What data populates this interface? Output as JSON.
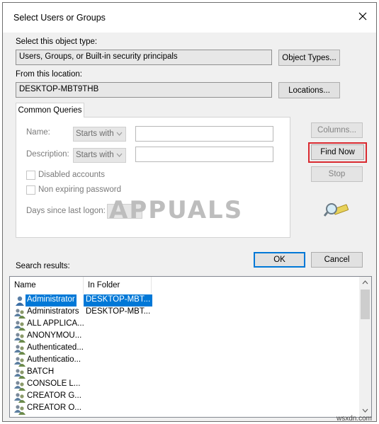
{
  "window": {
    "title": "Select Users or Groups"
  },
  "object_type": {
    "label": "Select this object type:",
    "value": "Users, Groups, or Built-in security principals",
    "button": "Object Types..."
  },
  "location": {
    "label": "From this location:",
    "value": "DESKTOP-MBT9THB",
    "button": "Locations..."
  },
  "queries": {
    "tab": "Common Queries",
    "name_label": "Name:",
    "name_mode": "Starts with",
    "description_label": "Description:",
    "description_mode": "Starts with",
    "disabled_accounts": "Disabled accounts",
    "non_expiring": "Non expiring password",
    "days_label": "Days since last logon:"
  },
  "buttons": {
    "columns": "Columns...",
    "find_now": "Find Now",
    "stop": "Stop",
    "ok": "OK",
    "cancel": "Cancel"
  },
  "watermark": "APPUALS",
  "results": {
    "label": "Search results:",
    "columns": [
      "Name",
      "In Folder"
    ],
    "rows": [
      {
        "name": "Administrator",
        "folder": "DESKTOP-MBT...",
        "icon": "user-icon"
      },
      {
        "name": "Administrators",
        "folder": "DESKTOP-MBT...",
        "icon": "group-icon"
      },
      {
        "name": "ALL APPLICA...",
        "folder": "",
        "icon": "group-icon"
      },
      {
        "name": "ANONYMOU...",
        "folder": "",
        "icon": "group-icon"
      },
      {
        "name": "Authenticated...",
        "folder": "",
        "icon": "group-icon"
      },
      {
        "name": "Authenticatio...",
        "folder": "",
        "icon": "group-icon"
      },
      {
        "name": "BATCH",
        "folder": "",
        "icon": "group-icon"
      },
      {
        "name": "CONSOLE L...",
        "folder": "",
        "icon": "group-icon"
      },
      {
        "name": "CREATOR G...",
        "folder": "",
        "icon": "group-icon"
      },
      {
        "name": "CREATOR O...",
        "folder": "",
        "icon": "group-icon"
      }
    ]
  },
  "colors": {
    "selection": "#0078d7",
    "highlight_box": "#d9292f"
  },
  "site": {
    "watermark": "wsxdn.com"
  }
}
